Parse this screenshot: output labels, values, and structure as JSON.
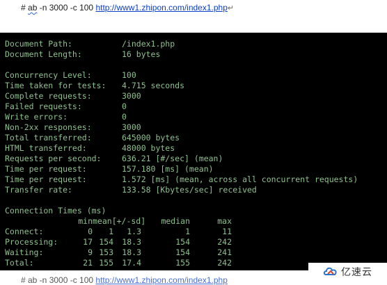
{
  "document": {
    "command_prefix": "# ",
    "command_ab": "ab",
    "command_args": " -n 3000 -c 100 ",
    "command_url": "http://www1.zhipon.com/index1.php",
    "para_mark": "↵",
    "bottom_prefix": "# ab -n 3000 -c 100 ",
    "bottom_url": "http://www1.zhipon.com/index1.php"
  },
  "terminal": {
    "doc_info": [
      {
        "label": "Document Path:",
        "value": "/index1.php"
      },
      {
        "label": "Document Length:",
        "value": "16 bytes"
      }
    ],
    "stats": [
      {
        "label": "Concurrency Level:",
        "value": "100"
      },
      {
        "label": "Time taken for tests:",
        "value": "4.715 seconds"
      },
      {
        "label": "Complete requests:",
        "value": "3000"
      },
      {
        "label": "Failed requests:",
        "value": "0"
      },
      {
        "label": "Write errors:",
        "value": "0"
      },
      {
        "label": "Non-2xx responses:",
        "value": "3000"
      },
      {
        "label": "Total transferred:",
        "value": "645000 bytes"
      },
      {
        "label": "HTML transferred:",
        "value": "48000 bytes"
      },
      {
        "label": "Requests per second:",
        "value": "636.21 [#/sec] (mean)"
      },
      {
        "label": "Time per request:",
        "value": "157.180 [ms] (mean)"
      },
      {
        "label": "Time per request:",
        "value": "1.572 [ms] (mean, across all concurrent requests)"
      },
      {
        "label": "Transfer rate:",
        "value": "133.58 [Kbytes/sec] received"
      }
    ],
    "connection_times": {
      "title": "Connection Times (ms)",
      "headers": [
        "",
        "min",
        "mean[+/-sd]",
        "",
        "median",
        "max"
      ],
      "rows": [
        [
          "Connect:",
          "0",
          "1",
          "1.3",
          "1",
          "11"
        ],
        [
          "Processing:",
          "17",
          "154",
          "18.3",
          "154",
          "242"
        ],
        [
          "Waiting:",
          "9",
          "153",
          "18.3",
          "154",
          "241"
        ],
        [
          "Total:",
          "21",
          "155",
          "17.4",
          "155",
          "242"
        ]
      ]
    },
    "text_color": "#8fc08f",
    "background": "#000000"
  },
  "watermark": {
    "text": "亿速云",
    "logo_icon": "yisu-cloud-logo-icon"
  }
}
